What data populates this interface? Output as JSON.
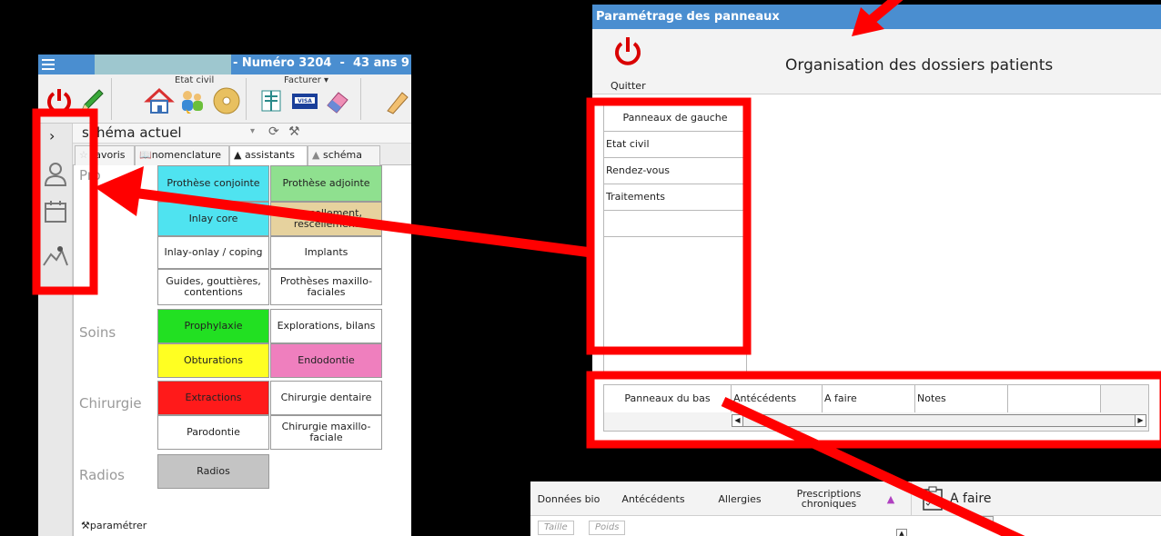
{
  "left_app": {
    "title_number": "- Numéro 3204  -  43 ans 9",
    "toolbar": {
      "etat_civil_label": "Etat civil",
      "facturer_label": "Facturer"
    },
    "scheme_select_value": "schéma actuel",
    "tabs": [
      "favoris",
      "nomenclature",
      "assistants",
      "schéma"
    ],
    "active_tab": "assistants",
    "categories": [
      "Soins",
      "Chirurgie",
      "Radios"
    ],
    "buttons": [
      {
        "label": "Prothèse conjointe",
        "color": "#4fe3f0"
      },
      {
        "label": "Prothèse adjointe",
        "color": "#8fe08f"
      },
      {
        "label": "Inlay core",
        "color": "#4fe3f0"
      },
      {
        "label": "Descellement, rescellement",
        "color": "#e6d29e"
      },
      {
        "label": "Inlay-onlay / coping",
        "color": "#ffffff"
      },
      {
        "label": "Implants",
        "color": "#ffffff"
      },
      {
        "label": "Guides, gouttières, contentions",
        "color": "#ffffff"
      },
      {
        "label": "Prothèses maxillo-faciales",
        "color": "#ffffff"
      },
      {
        "label": "Prophylaxie",
        "color": "#22e022"
      },
      {
        "label": "Explorations, bilans",
        "color": "#ffffff"
      },
      {
        "label": "Obturations",
        "color": "#ffff22"
      },
      {
        "label": "Endodontie",
        "color": "#ef7fbe"
      },
      {
        "label": "Extractions",
        "color": "#ff1a1a"
      },
      {
        "label": "Chirurgie dentaire",
        "color": "#ffffff"
      },
      {
        "label": "Parodontie",
        "color": "#ffffff"
      },
      {
        "label": "Chirurgie maxillo-faciale",
        "color": "#ffffff"
      },
      {
        "label": "Radios",
        "color": "#c4c4c4"
      }
    ],
    "partial_category": "Pro",
    "param_link": "paramétrer"
  },
  "dialog": {
    "titlebar": "Paramétrage des panneaux",
    "quit_label": "Quitter",
    "title": "Organisation des dossiers patients",
    "left_panels_header": "Panneaux de gauche",
    "left_panels": [
      "Etat civil",
      "Rendez-vous",
      "Traitements",
      ""
    ],
    "bottom_panels_header": "Panneaux du bas",
    "bottom_panels": [
      "Antécédents",
      "A faire",
      "Notes",
      ""
    ]
  },
  "bottom_app": {
    "tabs": [
      "Données bio",
      "Antécédents",
      "Allergies",
      "Prescriptions chroniques"
    ],
    "afaire_label": "A faire",
    "chips": [
      "Taille",
      "Poids"
    ]
  },
  "colors": {
    "titlebar_blue": "#4a8ed0",
    "annotation_red": "#ff0000"
  }
}
